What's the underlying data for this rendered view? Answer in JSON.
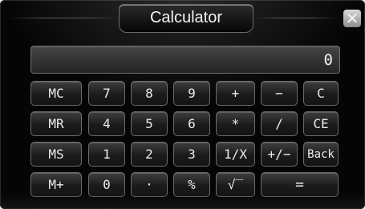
{
  "window": {
    "title": "Calculator",
    "close_label": "✕"
  },
  "display": {
    "value": "0"
  },
  "keys": {
    "mc": "MC",
    "k7": "7",
    "k8": "8",
    "k9": "9",
    "plus": "+",
    "minus": "−",
    "c": "C",
    "mr": "MR",
    "k4": "4",
    "k5": "5",
    "k6": "6",
    "mul": "*",
    "div": "/",
    "ce": "CE",
    "ms": "MS",
    "k1": "1",
    "k2": "2",
    "k3": "3",
    "recip": "1/X",
    "sign": "+/−",
    "back": "Back",
    "mplus": "M+",
    "k0": "0",
    "dot": "·",
    "pct": "%",
    "sqrt": "√‾",
    "eq": "="
  }
}
